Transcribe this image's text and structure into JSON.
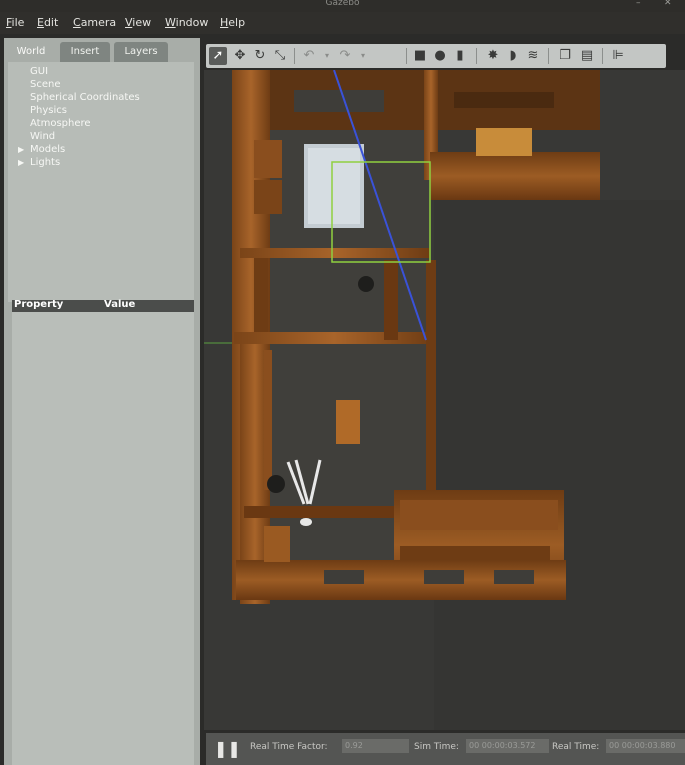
{
  "window": {
    "title": "Gazebo"
  },
  "menu": [
    "File",
    "Edit",
    "Camera",
    "View",
    "Window",
    "Help"
  ],
  "tabs": [
    "World",
    "Insert",
    "Layers"
  ],
  "world_tree": [
    {
      "label": "GUI",
      "expandable": false
    },
    {
      "label": "Scene",
      "expandable": false
    },
    {
      "label": "Spherical Coordinates",
      "expandable": false
    },
    {
      "label": "Physics",
      "expandable": false
    },
    {
      "label": "Atmosphere",
      "expandable": false
    },
    {
      "label": "Wind",
      "expandable": false
    },
    {
      "label": "Models",
      "expandable": true
    },
    {
      "label": "Lights",
      "expandable": true
    }
  ],
  "properties": {
    "col_property": "Property",
    "col_value": "Value"
  },
  "toolbar_icons": [
    "select-arrow-icon",
    "translate-icon",
    "rotate-icon",
    "scale-icon",
    "undo-icon",
    "undo-dropdown-icon",
    "redo-icon",
    "redo-dropdown-icon",
    "box-icon",
    "sphere-icon",
    "cylinder-icon",
    "point-light-icon",
    "spot-light-icon",
    "directional-light-icon",
    "copy-icon",
    "paste-icon",
    "align-icon"
  ],
  "bottom": {
    "real_time_factor_label": "Real Time Factor:",
    "real_time_factor": "0.92",
    "sim_time_label": "Sim Time:",
    "sim_time": "00 00:00:03.572",
    "real_time_label": "Real Time:",
    "real_time": "00 00:00:03.880"
  },
  "colors": {
    "wood": "#9a5a22",
    "wood_dark": "#6b3a14",
    "selection_box": "#8fd040",
    "axis_line": "#3a52d8",
    "panel": "#a8ada8"
  }
}
